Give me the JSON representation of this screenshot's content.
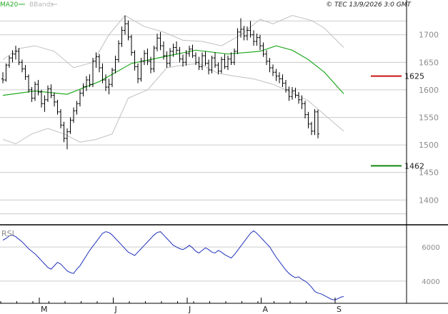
{
  "copyright": "© TEC 13/9/2026 3:0 GMT",
  "legend": [
    {
      "name": "MA20",
      "color": "#22aa22"
    },
    {
      "name": "BBands",
      "color": "#b8b8b8"
    }
  ],
  "colors": {
    "price": "#000000",
    "ma": "#22aa22",
    "bands": "#c0c0c0",
    "rsi": "#2233bb",
    "resistance": "#cc1111",
    "support": "#118811",
    "grid": "#cccccc",
    "frame": "#000000"
  },
  "chart_data": [
    {
      "type": "line",
      "panel": "price",
      "ylim": [
        1355,
        1745
      ],
      "yticks": [
        1400,
        1450,
        1500,
        1550,
        1600,
        1650,
        1700
      ],
      "months": [
        {
          "label": "M",
          "index": 12
        },
        {
          "label": "J",
          "index": 35
        },
        {
          "label": "J",
          "index": 58
        },
        {
          "label": "A",
          "index": 81
        },
        {
          "label": "S",
          "index": 104
        }
      ],
      "levels": [
        {
          "name": "resistance",
          "value": 1625,
          "label": "1625"
        },
        {
          "name": "support",
          "value": 1462,
          "label": "1462"
        }
      ],
      "ohlc": [
        [
          1620,
          1632,
          1612,
          1618
        ],
        [
          1618,
          1648,
          1615,
          1645
        ],
        [
          1645,
          1662,
          1640,
          1658
        ],
        [
          1658,
          1672,
          1650,
          1665
        ],
        [
          1665,
          1680,
          1655,
          1670
        ],
        [
          1670,
          1676,
          1645,
          1650
        ],
        [
          1650,
          1655,
          1632,
          1638
        ],
        [
          1638,
          1645,
          1618,
          1624
        ],
        [
          1624,
          1628,
          1595,
          1600
        ],
        [
          1600,
          1605,
          1578,
          1585
        ],
        [
          1585,
          1615,
          1580,
          1610
        ],
        [
          1610,
          1618,
          1590,
          1596
        ],
        [
          1596,
          1600,
          1568,
          1575
        ],
        [
          1575,
          1590,
          1560,
          1582
        ],
        [
          1582,
          1608,
          1578,
          1602
        ],
        [
          1602,
          1610,
          1585,
          1590
        ],
        [
          1590,
          1595,
          1570,
          1578
        ],
        [
          1578,
          1582,
          1555,
          1560
        ],
        [
          1560,
          1565,
          1530,
          1536
        ],
        [
          1536,
          1542,
          1505,
          1512
        ],
        [
          1512,
          1530,
          1492,
          1524
        ],
        [
          1524,
          1550,
          1520,
          1545
        ],
        [
          1545,
          1568,
          1540,
          1562
        ],
        [
          1562,
          1580,
          1555,
          1575
        ],
        [
          1575,
          1600,
          1570,
          1594
        ],
        [
          1594,
          1612,
          1588,
          1606
        ],
        [
          1606,
          1625,
          1598,
          1618
        ],
        [
          1618,
          1628,
          1605,
          1610
        ],
        [
          1610,
          1658,
          1605,
          1652
        ],
        [
          1652,
          1668,
          1640,
          1660
        ],
        [
          1660,
          1665,
          1632,
          1640
        ],
        [
          1640,
          1648,
          1612,
          1618
        ],
        [
          1618,
          1628,
          1598,
          1605
        ],
        [
          1605,
          1620,
          1592,
          1610
        ],
        [
          1610,
          1640,
          1605,
          1636
        ],
        [
          1636,
          1662,
          1630,
          1655
        ],
        [
          1655,
          1690,
          1650,
          1684
        ],
        [
          1684,
          1715,
          1678,
          1708
        ],
        [
          1708,
          1735,
          1700,
          1720
        ],
        [
          1720,
          1726,
          1690,
          1696
        ],
        [
          1696,
          1700,
          1662,
          1668
        ],
        [
          1668,
          1672,
          1635,
          1642
        ],
        [
          1642,
          1648,
          1612,
          1620
        ],
        [
          1620,
          1658,
          1615,
          1652
        ],
        [
          1652,
          1672,
          1645,
          1666
        ],
        [
          1666,
          1675,
          1645,
          1652
        ],
        [
          1652,
          1660,
          1630,
          1638
        ],
        [
          1638,
          1680,
          1632,
          1676
        ],
        [
          1676,
          1702,
          1670,
          1694
        ],
        [
          1694,
          1705,
          1672,
          1680
        ],
        [
          1680,
          1688,
          1655,
          1662
        ],
        [
          1662,
          1670,
          1640,
          1648
        ],
        [
          1648,
          1676,
          1642,
          1670
        ],
        [
          1670,
          1684,
          1660,
          1677
        ],
        [
          1677,
          1688,
          1665,
          1672
        ],
        [
          1672,
          1678,
          1650,
          1656
        ],
        [
          1656,
          1664,
          1642,
          1650
        ],
        [
          1650,
          1672,
          1644,
          1666
        ],
        [
          1666,
          1680,
          1660,
          1674
        ],
        [
          1674,
          1682,
          1658,
          1662
        ],
        [
          1662,
          1668,
          1645,
          1650
        ],
        [
          1650,
          1660,
          1636,
          1642
        ],
        [
          1642,
          1668,
          1636,
          1662
        ],
        [
          1662,
          1670,
          1644,
          1648
        ],
        [
          1648,
          1655,
          1628,
          1636
        ],
        [
          1636,
          1662,
          1630,
          1658
        ],
        [
          1658,
          1668,
          1640,
          1645
        ],
        [
          1645,
          1650,
          1628,
          1634
        ],
        [
          1634,
          1660,
          1630,
          1655
        ],
        [
          1655,
          1665,
          1638,
          1642
        ],
        [
          1642,
          1662,
          1636,
          1656
        ],
        [
          1656,
          1668,
          1645,
          1650
        ],
        [
          1650,
          1675,
          1645,
          1670
        ],
        [
          1670,
          1712,
          1665,
          1705
        ],
        [
          1705,
          1730,
          1695,
          1710
        ],
        [
          1710,
          1716,
          1690,
          1698
        ],
        [
          1698,
          1715,
          1690,
          1708
        ],
        [
          1708,
          1725,
          1695,
          1700
        ],
        [
          1700,
          1708,
          1680,
          1688
        ],
        [
          1688,
          1702,
          1680,
          1695
        ],
        [
          1695,
          1700,
          1672,
          1680
        ],
        [
          1680,
          1686,
          1660,
          1665
        ],
        [
          1665,
          1672,
          1645,
          1652
        ],
        [
          1652,
          1658,
          1632,
          1640
        ],
        [
          1640,
          1646,
          1625,
          1632
        ],
        [
          1632,
          1638,
          1616,
          1625
        ],
        [
          1625,
          1632,
          1612,
          1620
        ],
        [
          1620,
          1628,
          1605,
          1612
        ],
        [
          1612,
          1618,
          1595,
          1600
        ],
        [
          1600,
          1606,
          1580,
          1588
        ],
        [
          1588,
          1605,
          1582,
          1598
        ],
        [
          1598,
          1604,
          1585,
          1590
        ],
        [
          1590,
          1596,
          1575,
          1582
        ],
        [
          1582,
          1590,
          1565,
          1575
        ],
        [
          1575,
          1580,
          1548,
          1555
        ],
        [
          1555,
          1560,
          1530,
          1538
        ],
        [
          1538,
          1542,
          1518,
          1525
        ],
        [
          1525,
          1565,
          1518,
          1560
        ],
        [
          1560,
          1564,
          1512,
          1520
        ]
      ],
      "ma20": [
        [
          0,
          1590
        ],
        [
          10,
          1598
        ],
        [
          20,
          1592
        ],
        [
          30,
          1615
        ],
        [
          40,
          1648
        ],
        [
          50,
          1660
        ],
        [
          60,
          1672
        ],
        [
          70,
          1665
        ],
        [
          80,
          1670
        ],
        [
          85,
          1680
        ],
        [
          90,
          1672
        ],
        [
          95,
          1655
        ],
        [
          100,
          1632
        ],
        [
          106,
          1593
        ]
      ],
      "bb_upper": [
        [
          0,
          1655
        ],
        [
          5,
          1675
        ],
        [
          10,
          1680
        ],
        [
          16,
          1670
        ],
        [
          22,
          1640
        ],
        [
          28,
          1650
        ],
        [
          33,
          1700
        ],
        [
          38,
          1735
        ],
        [
          44,
          1715
        ],
        [
          50,
          1705
        ],
        [
          56,
          1690
        ],
        [
          62,
          1688
        ],
        [
          68,
          1680
        ],
        [
          74,
          1700
        ],
        [
          80,
          1728
        ],
        [
          84,
          1720
        ],
        [
          90,
          1735
        ],
        [
          96,
          1726
        ],
        [
          100,
          1712
        ],
        [
          106,
          1677
        ]
      ],
      "bb_lower": [
        [
          0,
          1510
        ],
        [
          4,
          1502
        ],
        [
          9,
          1520
        ],
        [
          14,
          1530
        ],
        [
          19,
          1520
        ],
        [
          24,
          1505
        ],
        [
          29,
          1510
        ],
        [
          34,
          1520
        ],
        [
          39,
          1585
        ],
        [
          45,
          1600
        ],
        [
          51,
          1640
        ],
        [
          56,
          1645
        ],
        [
          61,
          1648
        ],
        [
          67,
          1630
        ],
        [
          72,
          1625
        ],
        [
          78,
          1620
        ],
        [
          84,
          1610
        ],
        [
          90,
          1595
        ],
        [
          95,
          1580
        ],
        [
          100,
          1555
        ],
        [
          106,
          1525
        ]
      ]
    },
    {
      "type": "line",
      "panel": "rsi",
      "name": "RSI",
      "ylim": [
        2700,
        7300
      ],
      "yticks": [
        4000,
        6000
      ],
      "values": [
        6400,
        6500,
        6650,
        6700,
        6600,
        6450,
        6300,
        6100,
        5900,
        5750,
        5600,
        5400,
        5200,
        5000,
        4800,
        4700,
        4900,
        5100,
        5000,
        4800,
        4600,
        4500,
        4450,
        4700,
        4900,
        5200,
        5500,
        5800,
        6050,
        6300,
        6550,
        6800,
        6900,
        6850,
        6700,
        6500,
        6300,
        6100,
        5900,
        5700,
        5600,
        5500,
        5700,
        5900,
        6100,
        6300,
        6500,
        6700,
        6850,
        6900,
        6700,
        6500,
        6300,
        6100,
        6000,
        5900,
        5850,
        5950,
        6100,
        5950,
        5750,
        5650,
        5800,
        5950,
        5850,
        5700,
        5650,
        5800,
        5700,
        5550,
        5450,
        5350,
        5550,
        5800,
        6050,
        6300,
        6550,
        6800,
        6950,
        6800,
        6600,
        6400,
        6200,
        6000,
        5700,
        5400,
        5150,
        4900,
        4650,
        4450,
        4300,
        4200,
        4250,
        4100,
        4000,
        3850,
        3650,
        3400,
        3300,
        3250,
        3150,
        3050,
        2950,
        2900,
        2950,
        3050,
        3100
      ]
    }
  ]
}
